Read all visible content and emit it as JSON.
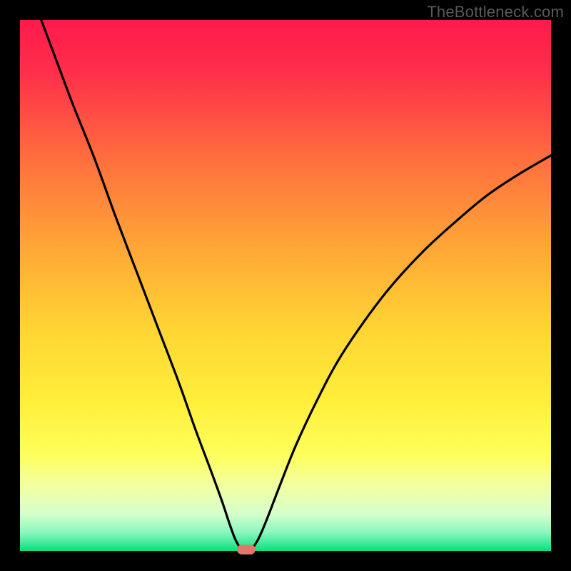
{
  "watermark": "TheBottleneck.com",
  "chart_data": {
    "type": "line",
    "title": "",
    "xlabel": "",
    "ylabel": "",
    "xlim": [
      0,
      100
    ],
    "ylim": [
      0,
      100
    ],
    "background_gradient_stops": [
      {
        "offset": 0.0,
        "color": "#ff1a4b"
      },
      {
        "offset": 0.1,
        "color": "#ff2f4a"
      },
      {
        "offset": 0.25,
        "color": "#ff6a3e"
      },
      {
        "offset": 0.42,
        "color": "#ffa436"
      },
      {
        "offset": 0.58,
        "color": "#ffd433"
      },
      {
        "offset": 0.72,
        "color": "#ffef3a"
      },
      {
        "offset": 0.82,
        "color": "#fdff5c"
      },
      {
        "offset": 0.88,
        "color": "#f2ffa4"
      },
      {
        "offset": 0.93,
        "color": "#d6ffcb"
      },
      {
        "offset": 0.965,
        "color": "#8af7be"
      },
      {
        "offset": 1.0,
        "color": "#09e07e"
      }
    ],
    "series": [
      {
        "name": "curve-left",
        "x": [
          4.0,
          7.0,
          10.0,
          14.0,
          18.0,
          22.0,
          26.0,
          30.0,
          33.0,
          36.0,
          38.0,
          39.5,
          40.5,
          41.3
        ],
        "y": [
          100.0,
          92.0,
          84.0,
          74.0,
          63.0,
          52.5,
          42.0,
          31.5,
          23.0,
          15.0,
          9.5,
          5.0,
          2.3,
          0.8
        ]
      },
      {
        "name": "curve-right",
        "x": [
          44.0,
          45.0,
          46.5,
          49.0,
          52.0,
          56.0,
          60.0,
          65.0,
          70.0,
          76.0,
          82.0,
          88.0,
          94.0,
          100.0
        ],
        "y": [
          0.8,
          2.5,
          6.0,
          12.5,
          20.0,
          28.5,
          36.0,
          43.5,
          50.0,
          56.5,
          62.0,
          67.0,
          71.0,
          74.5
        ]
      }
    ],
    "marker": {
      "x": 42.6,
      "y": 0.0,
      "width_pct": 3.5,
      "height_pct": 1.8,
      "color": "#e4766c"
    }
  }
}
